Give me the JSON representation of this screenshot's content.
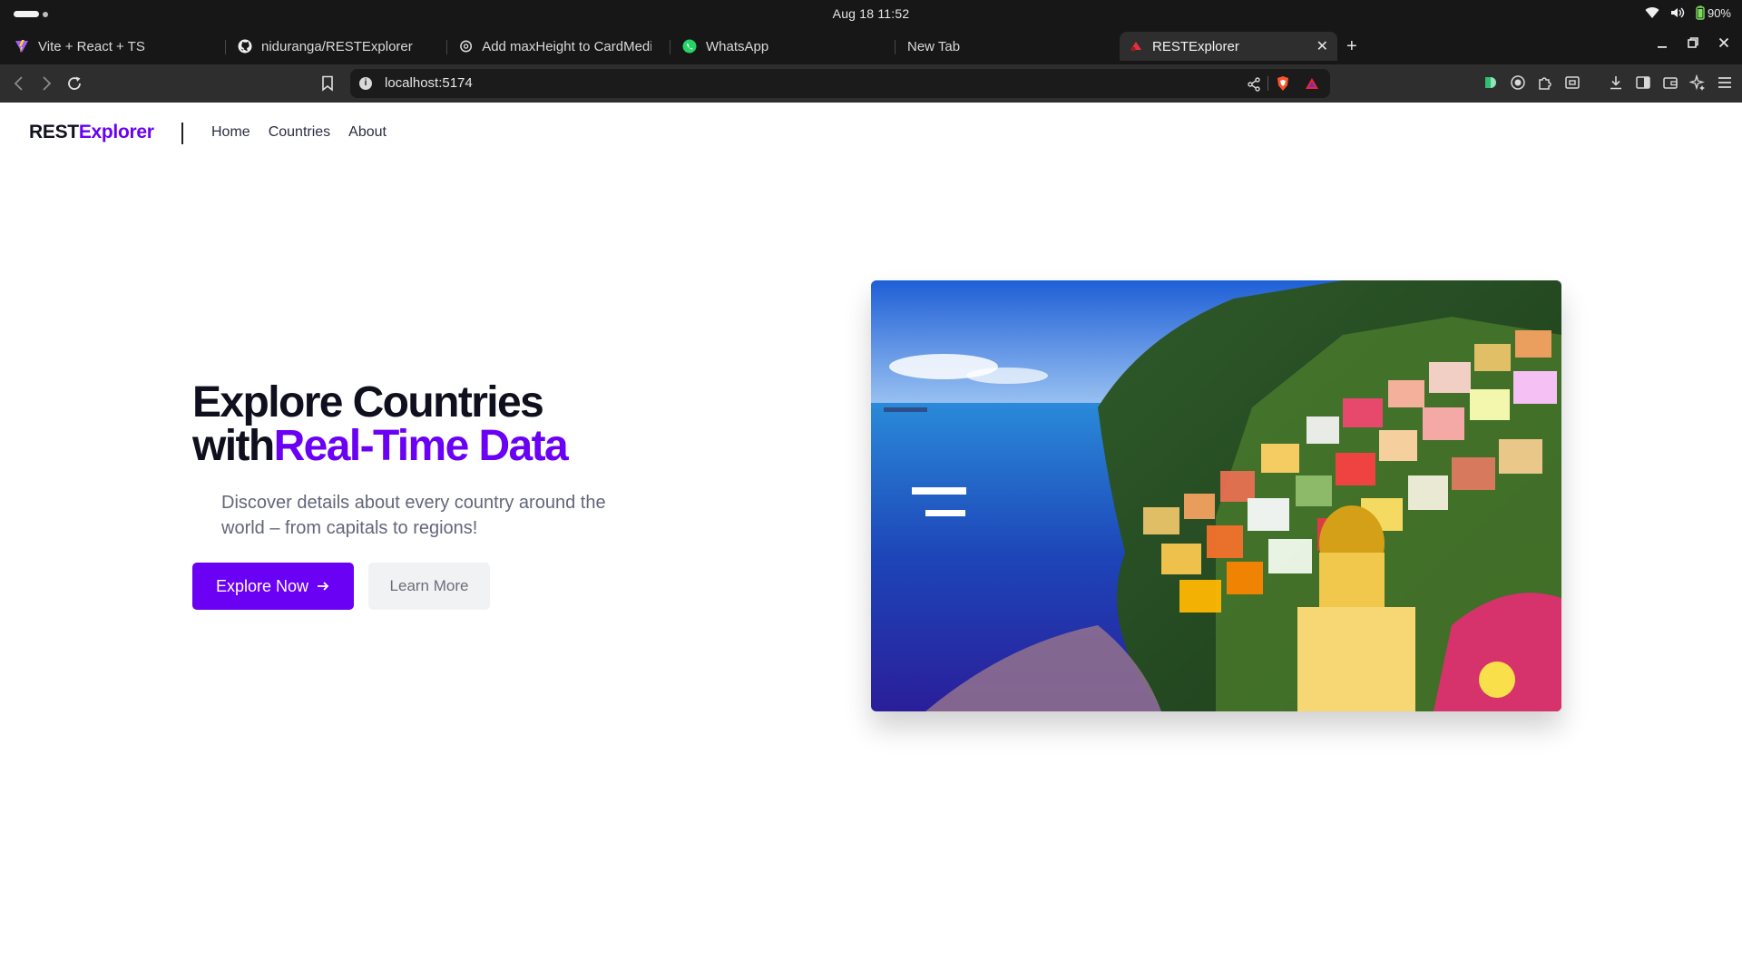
{
  "os": {
    "clock": "Aug 18  11:52",
    "battery": "90%"
  },
  "browser": {
    "tabs": [
      {
        "label": "Vite + React + TS",
        "icon": "vite-icon"
      },
      {
        "label": "niduranga/RESTExplorer",
        "icon": "github-icon"
      },
      {
        "label": "Add maxHeight to CardMedia",
        "icon": "openai-icon"
      },
      {
        "label": "WhatsApp",
        "icon": "whatsapp-icon"
      },
      {
        "label": "New Tab",
        "icon": ""
      },
      {
        "label": "RESTExplorer",
        "icon": "app-favicon",
        "active": true
      }
    ],
    "url": "localhost:5174",
    "colors": {
      "chrome_bg": "#171717",
      "toolbar_bg": "#2e2e2e",
      "url_bg": "#1b1b1b"
    }
  },
  "site": {
    "brand_part1": "REST",
    "brand_part2": "Explorer",
    "nav": [
      "Home",
      "Countries",
      "About"
    ],
    "hero": {
      "title_line1": "Explore Countries",
      "title_line2_plain": "with",
      "title_line2_accent": "Real-Time Data",
      "subtitle": "Discover details about every country around the world – from capitals to regions!",
      "primary_button": "Explore Now",
      "secondary_button": "Learn More",
      "image_subject": "coastal-village-photo"
    },
    "colors": {
      "accent": "#6a00f4",
      "title": "#0f0f1e",
      "subtitle": "#62667a",
      "secondary_btn_bg": "#f1f2f4"
    }
  }
}
